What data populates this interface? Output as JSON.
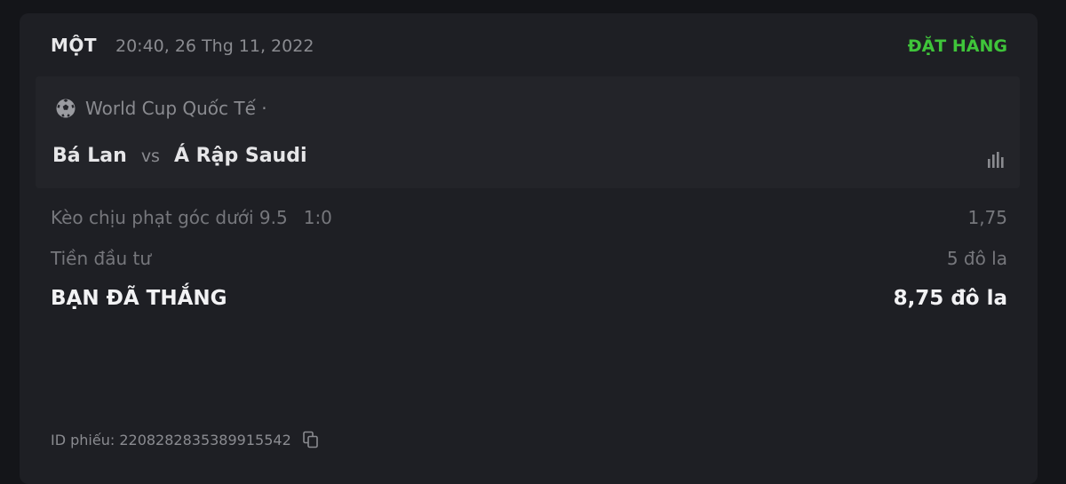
{
  "ticket": {
    "type_label": "MỘT",
    "datetime": "20:40, 26 Thg 11, 2022",
    "status": "ĐẶT HÀNG",
    "status_color": "#3fc43a",
    "league": {
      "icon": "soccer-ball-icon",
      "name": "World Cup Quốc Tế ·"
    },
    "match": {
      "home": "Bá Lan",
      "vs": "vs",
      "away": "Á Rập Saudi",
      "stats_icon": "bar-chart-icon"
    },
    "bet": {
      "market": "Kèo chịu phạt góc dưới 9.5",
      "score": "1:0",
      "odds": "1,75"
    },
    "stake": {
      "label": "Tiền đầu tư",
      "value": "5 đô la"
    },
    "win": {
      "label": "BẠN ĐÃ THẮNG",
      "value": "8,75 đô la"
    },
    "id": {
      "text": "ID phiếu: 22082828353899155​42",
      "copy_icon": "copy-icon"
    }
  }
}
